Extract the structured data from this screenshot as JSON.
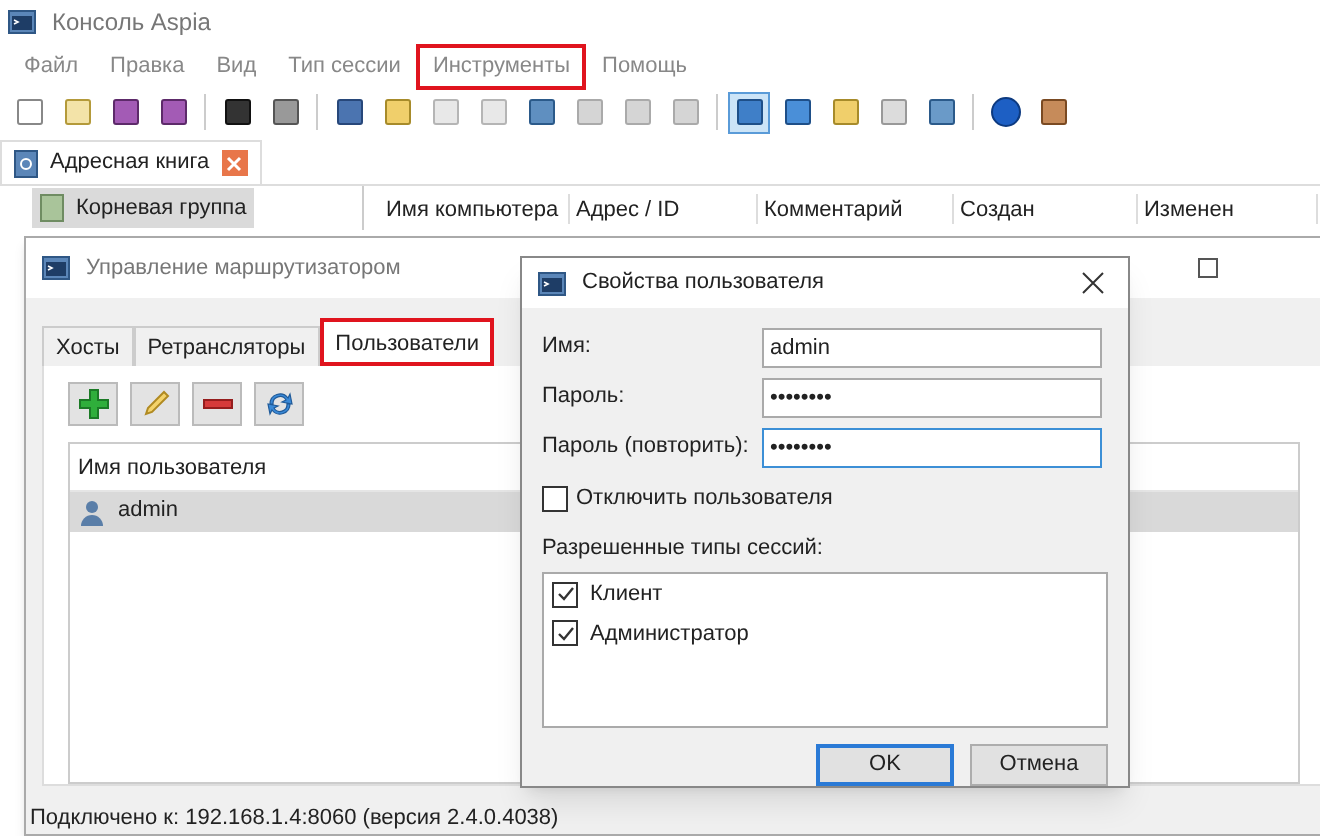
{
  "main_window": {
    "title": "Консоль Aspia",
    "menu": [
      {
        "label": "Файл",
        "highlighted": false
      },
      {
        "label": "Правка",
        "highlighted": false
      },
      {
        "label": "Вид",
        "highlighted": false
      },
      {
        "label": "Тип сессии",
        "highlighted": false
      },
      {
        "label": "Инструменты",
        "highlighted": true
      },
      {
        "label": "Помощь",
        "highlighted": false
      }
    ],
    "tab": {
      "label": "Адресная книга"
    },
    "tree": [
      {
        "label": "Корневая группа",
        "selected": true
      }
    ],
    "columns": [
      "Имя компьютера",
      "Адрес / ID",
      "Комментарий",
      "Создан",
      "Изменен"
    ]
  },
  "router_window": {
    "title": "Управление маршрутизатором",
    "tabs": [
      {
        "label": "Хосты",
        "selected": false,
        "highlighted": false
      },
      {
        "label": "Ретрансляторы",
        "selected": false,
        "highlighted": false
      },
      {
        "label": "Пользователи",
        "selected": true,
        "highlighted": true
      }
    ],
    "column": "Имя пользователя",
    "users": [
      {
        "name": "admin",
        "selected": true
      }
    ],
    "status_bar": "Подключено к: 192.168.1.4:8060 (версия 2.4.0.4038)"
  },
  "dialog": {
    "title": "Свойства пользователя",
    "fields": [
      {
        "label": "Имя:",
        "value": "admin",
        "focused": false
      },
      {
        "label": "Пароль:",
        "value": "••••••••",
        "focused": false
      },
      {
        "label": "Пароль (повторить):",
        "value": "••••••••",
        "focused": true
      }
    ],
    "disable_user": {
      "label": "Отключить пользователя",
      "checked": false
    },
    "sessions_label": "Разрешенные типы сессий:",
    "sessions": [
      {
        "label": "Клиент",
        "checked": true
      },
      {
        "label": "Администратор",
        "checked": true
      }
    ],
    "buttons": [
      {
        "label": "OK",
        "default": true
      },
      {
        "label": "Отмена",
        "default": false
      }
    ]
  }
}
